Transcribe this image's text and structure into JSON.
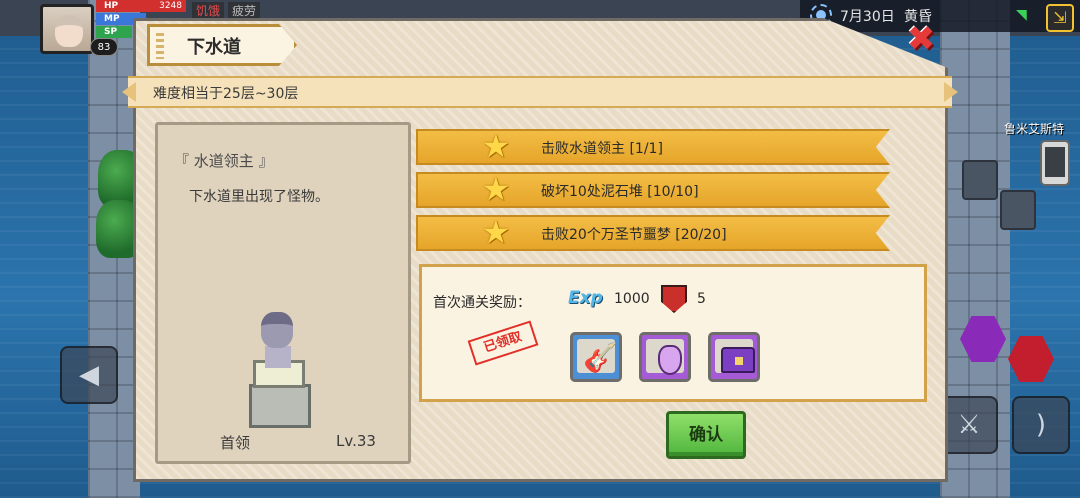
{
  "hud": {
    "hp_label": "HP",
    "hp_value": "3248",
    "mp_label": "MP",
    "sp_label": "SP",
    "player_level": "83",
    "status_tags": [
      "饥饿",
      "疲劳"
    ],
    "date": "7月30日",
    "time_of_day": "黄昏",
    "npc_name": "鲁米艾斯特"
  },
  "dialog": {
    "title": "下水道",
    "difficulty": "难度相当于25层~30层",
    "boss": {
      "name": "『 水道领主 』",
      "description": "下水道里出现了怪物。",
      "role": "首领",
      "level": "Lv.33"
    },
    "objectives": [
      {
        "text": "击败水道领主 [1/1]"
      },
      {
        "text": "破坏10处泥石堆 [10/10]"
      },
      {
        "text": "击败20个万圣节噩梦 [20/20]"
      }
    ],
    "reward": {
      "label": "首次通关奖励：",
      "exp_icon": "Exp",
      "exp_value": "1000",
      "shield_value": "5",
      "claimed_stamp": "已领取",
      "items": [
        "guitar-icon",
        "potion-icon",
        "chest-icon"
      ]
    },
    "confirm_label": "确认"
  },
  "colors": {
    "objective_bar": "#e6a52a",
    "confirm_green": "#4fb43c",
    "stamp_red": "#e0302a",
    "close_red": "#e63a3a"
  }
}
